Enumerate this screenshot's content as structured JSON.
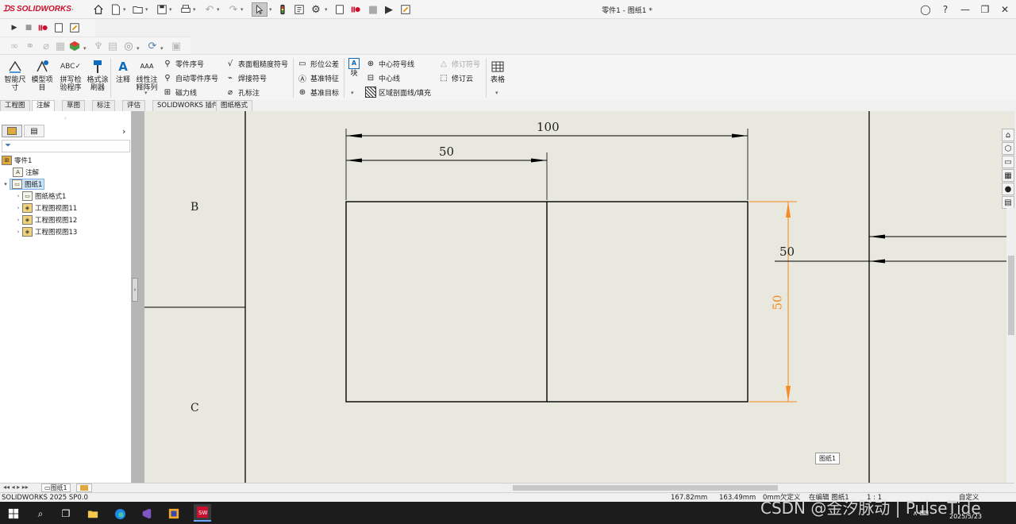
{
  "app": {
    "brand": "SOLIDWORKS",
    "doc_title": "零件1 - 图纸1 *"
  },
  "ribbon": {
    "smart_dim": "智能尺寸",
    "model_items": "模型项目",
    "spell_check": "拼写检验程序",
    "format_painter": "格式涂刷器",
    "note": "注释",
    "linear_note": "线性注释阵列",
    "balloon": "零件序号",
    "auto_balloon": "自动零件序号",
    "magnetic_line": "磁力线",
    "surface_finish": "表面粗糙度符号",
    "weld_symbol": "焊接符号",
    "hole_callout": "孔标注",
    "geo_tol": "形位公差",
    "datum_feature": "基准特征",
    "datum_target": "基准目标",
    "block": "块",
    "center_mark": "中心符号线",
    "centerline": "中心线",
    "area_hatch": "区域剖面线/填充",
    "revision_symbol": "修订符号",
    "revision_cloud": "修订云",
    "table": "表格"
  },
  "tabs": [
    "工程图",
    "注解",
    "草图",
    "标注",
    "评估",
    "SOLIDWORKS 插件",
    "图纸格式"
  ],
  "tree": {
    "root": "零件1",
    "items": [
      {
        "label": "注解"
      },
      {
        "label": "图纸1"
      },
      {
        "label": "图纸格式1"
      },
      {
        "label": "工程图视图11"
      },
      {
        "label": "工程图视图12"
      },
      {
        "label": "工程图视图13"
      }
    ]
  },
  "drawing": {
    "zone_b": "B",
    "zone_c": "C",
    "dim_100": "100",
    "dim_50_top": "50",
    "dim_50_right": "50",
    "dim_50_side": "50",
    "sheet_tag": "图纸1"
  },
  "sheet_tab": "图纸1",
  "status": {
    "version": "SOLIDWORKS 2025 SP0.0",
    "x": "167.82mm",
    "y": "163.49mm",
    "z": "0mm",
    "defined": "欠定义",
    "editing": "在编辑 图纸1",
    "scale": "1 : 1",
    "custom": "自定义"
  },
  "taskbar": {
    "date": "2025/5/23"
  },
  "watermark": "CSDN @金汐脉动 | PulseTide",
  "colors": {
    "brand": "#c8102e",
    "dim_orange": "#f58a1f",
    "canvas": "#e8e8de",
    "accent": "#0f6cbd"
  }
}
